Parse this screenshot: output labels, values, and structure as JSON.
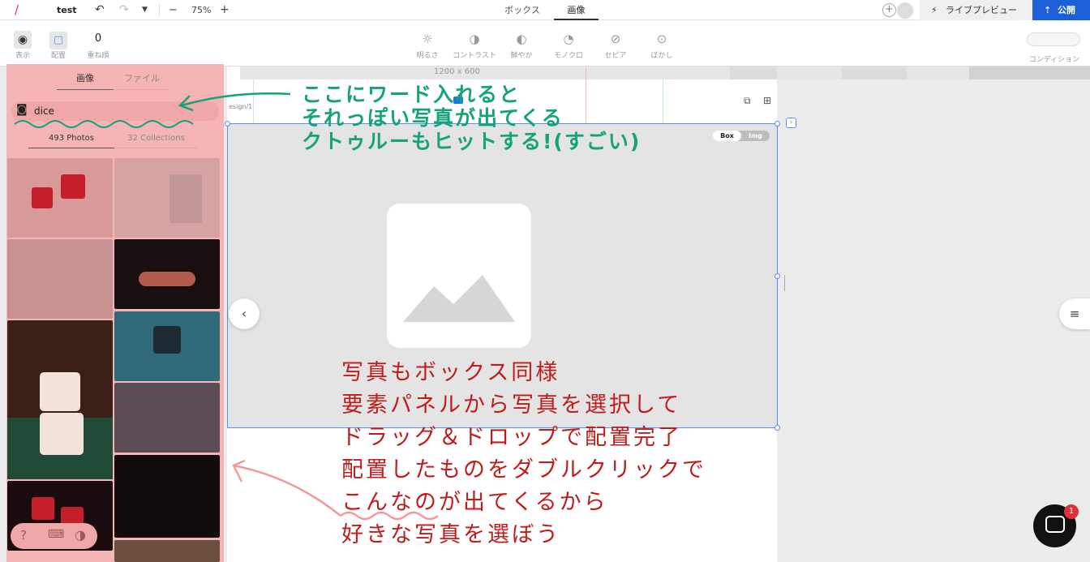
{
  "topbar": {
    "project_name": "test",
    "zoom": "75%",
    "zoom_minus": "−",
    "zoom_plus": "+",
    "tabs": [
      {
        "label": "ボックス"
      },
      {
        "label": "画像",
        "active": true
      }
    ],
    "live_preview": "ライブプレビュー",
    "publish": "公開"
  },
  "toolbar": {
    "left": [
      {
        "label": "表示",
        "icon": "eye-icon"
      },
      {
        "label": "配置",
        "icon": "layout-icon"
      },
      {
        "label": "重ね順",
        "value": "0"
      }
    ],
    "filters": [
      {
        "label": "明るさ",
        "icon": "sun-icon"
      },
      {
        "label": "コントラスト",
        "icon": "contrast-icon"
      },
      {
        "label": "鮮やか",
        "icon": "saturation-icon"
      },
      {
        "label": "モノクロ",
        "icon": "monochrome-icon"
      },
      {
        "label": "セピア",
        "icon": "sepia-icon"
      },
      {
        "label": "ぼかし",
        "icon": "blur-icon"
      }
    ],
    "condition_label": "コンディション"
  },
  "canvas": {
    "size_label": "1200 x 600",
    "breadcrumb": "esign/1",
    "toggle_box": "Box",
    "toggle_img": "Img"
  },
  "panel": {
    "tabs": [
      {
        "label": "画像",
        "active": true
      },
      {
        "label": "ファイル"
      }
    ],
    "search_value": "dice",
    "result_tabs": [
      {
        "label": "493 Photos",
        "active": true
      },
      {
        "label": "32 Collections"
      }
    ]
  },
  "annotations": {
    "green": [
      "ここにワード入れると",
      "それっぽい写真が出てくる",
      "クトゥルーもヒットする!(すごい)"
    ],
    "red": [
      "写真もボックス同様",
      "要素パネルから写真を選択して",
      "ドラッグ＆ドロップで配置完了",
      "配置したものをダブルクリックで",
      "こんなのが出てくるから",
      "好きな写真を選ぼう"
    ]
  },
  "chat": {
    "badge": "1"
  },
  "colors": {
    "accent": "#5b8ef0",
    "publish_bg": "#1c5fd6",
    "panel_overlay": "#f5b5b5",
    "annotation_green": "#16a37a",
    "annotation_red": "#c01c1c"
  }
}
